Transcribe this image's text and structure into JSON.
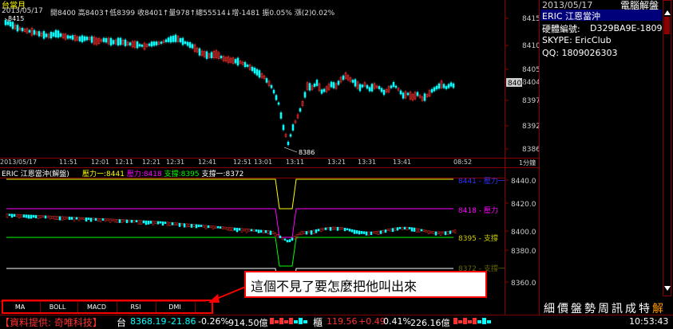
{
  "header": {
    "title": "台當月",
    "date": "2013/05/17",
    "quote": "開8400 高8403↑低8399 收8401↑量978↑總55514↓增-1481 振0.05% 漲(2)0.02%"
  },
  "price_panel": {
    "yticks": [
      "8415",
      "8410",
      "8405",
      "8404",
      "8401",
      "8397",
      "8392",
      "8386"
    ],
    "current": "8401",
    "high_label": "8415",
    "low_label": "8386",
    "xlabels": [
      "2013/05/17",
      "11:51",
      "12:01",
      "12:11",
      "12:21",
      "12:31",
      "12:41",
      "12:51",
      "13:01",
      "13:11",
      "13:21",
      "13:31",
      "13:41",
      "08:52",
      "1分鐘"
    ]
  },
  "indicator_panel": {
    "title": "ERIC 江恩當沖(解盤)",
    "legend": [
      {
        "text": "壓力一:8441",
        "color": "#ffff00"
      },
      {
        "text": "壓力:8418",
        "color": "#ff00ff"
      },
      {
        "text": "支撐:8395",
        "color": "#00ff00"
      },
      {
        "text": "支撐一:8372",
        "color": "#ffffff"
      }
    ],
    "line_labels": [
      {
        "text": "8441 - 壓力一",
        "color": "#3333ff"
      },
      {
        "text": "8418 - 壓力",
        "color": "#ff00ff"
      },
      {
        "text": "8395 - 支撐",
        "color": "#cccc00"
      },
      {
        "text": "8372 - 支撐一",
        "color": "#666600"
      }
    ],
    "yticks": [
      "8440.0",
      "8420.0",
      "8400.0",
      "8380.0",
      "8360.0"
    ]
  },
  "sidebar": {
    "date": "2013/05/17",
    "title": "電腦解盤",
    "name": "ERIC 江恩當沖",
    "hw_label": "硬體編號:",
    "hw_value": "D329BA9E-1809",
    "skype": "SKYPE: EricClub",
    "qq": "QQ: 1809026303",
    "vertical_tabs": [
      "解",
      "特",
      "成",
      "訊",
      "周",
      "勢",
      "盤",
      "價",
      "細"
    ]
  },
  "tabs": [
    "MA",
    "BOLL",
    "MACD",
    "RSI",
    "DMI"
  ],
  "annotation": "這個不見了要怎麼把他叫出來",
  "status_bar": {
    "provider": "【資料提供: 奇唯科技】",
    "tw_label": "台",
    "tw_value": "8368.19",
    "tw_change": "-21.86",
    "tw_pct": "-0.26%",
    "tw_vol": "914.50億",
    "otc_label": "櫃",
    "otc_value": "119.56",
    "otc_change": "+0.49",
    "otc_pct": "0.41%",
    "otc_vol": "226.16億",
    "time": "10:53:43"
  },
  "colors": {
    "up": "#ff3030",
    "down": "#00ffff",
    "frame": "#8a0000",
    "resist1": "#ffff00",
    "resist": "#ff00ff",
    "support": "#00ff00",
    "support1": "#ffffff",
    "highlight": "#00007a"
  }
}
